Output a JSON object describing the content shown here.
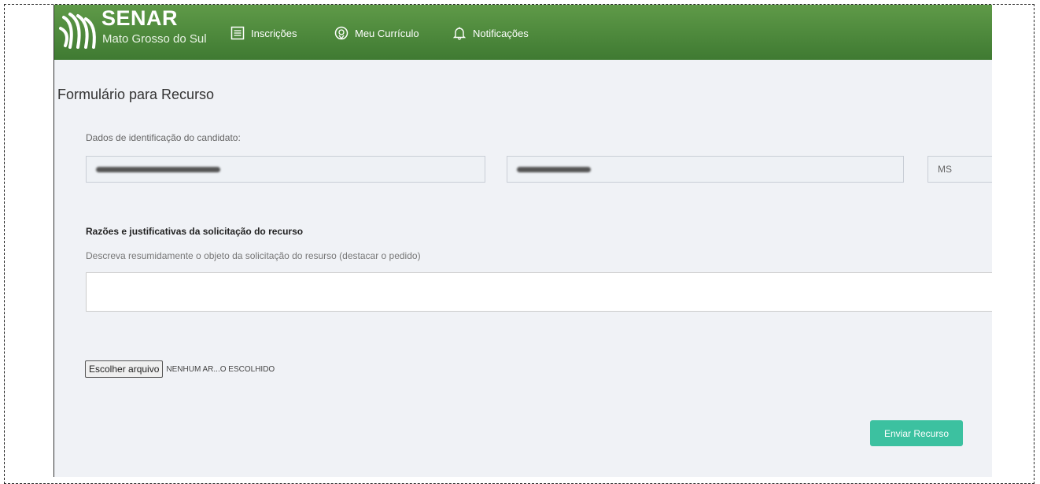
{
  "brand": {
    "title": "SENAR",
    "subtitle": "Mato Grosso do Sul",
    "color": "#4a8a3a"
  },
  "nav": {
    "items": [
      {
        "label": "Inscrições",
        "icon": "list-icon"
      },
      {
        "label": "Meu Currículo",
        "icon": "badge-icon"
      },
      {
        "label": "Notificações",
        "icon": "bell-icon"
      }
    ]
  },
  "page": {
    "title": "Formulário para Recurso"
  },
  "candidate": {
    "section_label": "Dados de identificação do candidato:",
    "fields": [
      {
        "value": "",
        "redacted": true
      },
      {
        "value": "",
        "redacted": true
      },
      {
        "value": "MS",
        "redacted": false
      }
    ]
  },
  "reasons": {
    "title": "Razões e justificativas da solicitação do recurso",
    "description": "Descreva resumidamente o objeto da solicitação do resurso (destacar o pedido)",
    "value": ""
  },
  "file_upload": {
    "button_label": "Escolher arquivo",
    "status": "NENHUM AR...O ESCOLHIDO"
  },
  "submit": {
    "label": "Enviar Recurso",
    "color": "#3cc1a0"
  }
}
